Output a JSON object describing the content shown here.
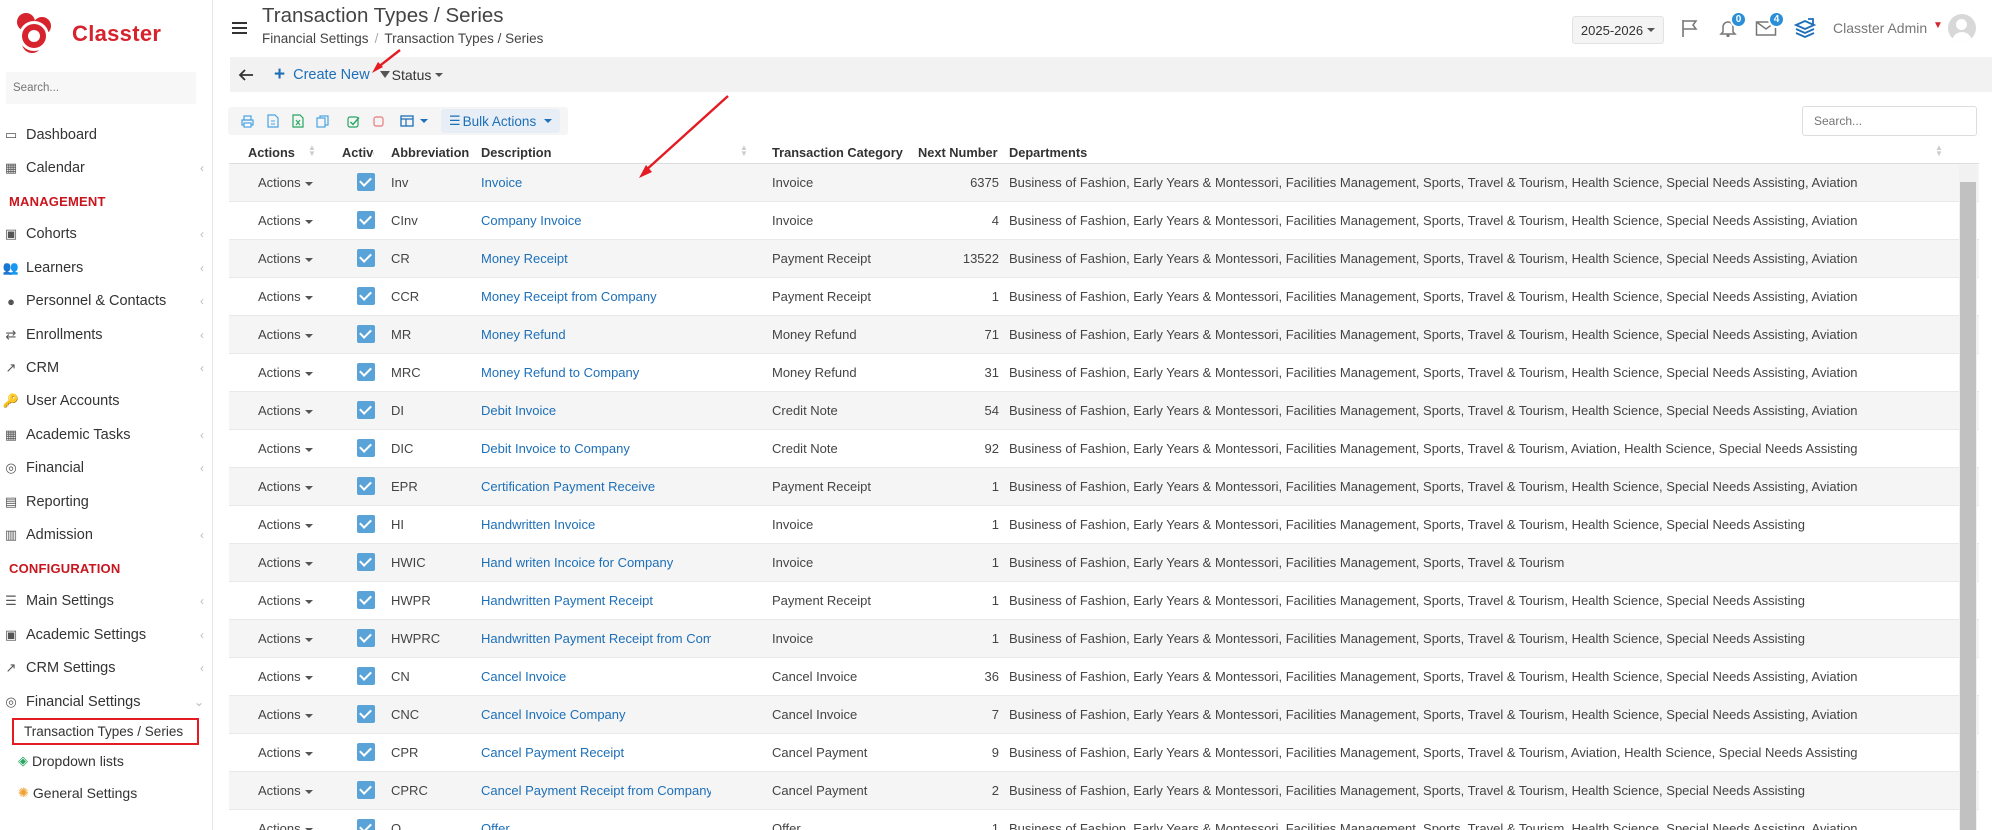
{
  "app": {
    "brand": "Classter"
  },
  "sidebar": {
    "search_placeholder": "Search...",
    "sections": [
      {
        "label": ""
      },
      {
        "label": "MANAGEMENT"
      },
      {
        "label": "CONFIGURATION"
      }
    ],
    "items": [
      {
        "label": "Dashboard",
        "icon": "laptop-icon",
        "chevron": false
      },
      {
        "label": "Calendar",
        "icon": "calendar-icon",
        "chevron": true
      },
      {
        "label": "Cohorts",
        "icon": "cohorts-icon",
        "chevron": true
      },
      {
        "label": "Learners",
        "icon": "learners-icon",
        "chevron": true
      },
      {
        "label": "Personnel & Contacts",
        "icon": "person-icon",
        "chevron": true
      },
      {
        "label": "Enrollments",
        "icon": "swap-icon",
        "chevron": true
      },
      {
        "label": "CRM",
        "icon": "trend-icon",
        "chevron": true
      },
      {
        "label": "User Accounts",
        "icon": "key-icon",
        "chevron": false
      },
      {
        "label": "Academic Tasks",
        "icon": "grid-icon",
        "chevron": true
      },
      {
        "label": "Financial",
        "icon": "coins-icon",
        "chevron": true
      },
      {
        "label": "Reporting",
        "icon": "printer-icon",
        "chevron": false
      },
      {
        "label": "Admission",
        "icon": "bank-icon",
        "chevron": true
      },
      {
        "label": "Main Settings",
        "icon": "sliders-icon",
        "chevron": true
      },
      {
        "label": "Academic Settings",
        "icon": "group-settings-icon",
        "chevron": true
      },
      {
        "label": "CRM Settings",
        "icon": "trend-icon",
        "chevron": true
      },
      {
        "label": "Financial Settings",
        "icon": "coins-icon",
        "chevron": true
      }
    ],
    "sub_items": [
      {
        "label": "Transaction Types / Series",
        "active": true
      },
      {
        "label": "Dropdown lists",
        "icon": "layers-icon"
      },
      {
        "label": "General Settings",
        "icon": "gear-icon"
      }
    ]
  },
  "header": {
    "title": "Transaction Types / Series",
    "breadcrumb": [
      "Financial Settings",
      "Transaction Types / Series"
    ],
    "year": "2025-2026",
    "notifications_count": "0",
    "messages_count": "4",
    "user_name": "Classter Admin"
  },
  "toolbar": {
    "create_label": "Create New",
    "status_label": "Status"
  },
  "table_tools": {
    "bulk_label": "Bulk Actions",
    "search_placeholder": "Search..."
  },
  "table": {
    "columns": [
      "Actions",
      "Active",
      "Abbreviation",
      "Description",
      "Transaction Category",
      "Next Number",
      "Departments"
    ],
    "action_label": "Actions",
    "rows": [
      {
        "abbr": "Inv",
        "desc": "Invoice",
        "cat": "Invoice",
        "next": "6375",
        "dept": "Business of Fashion, Early Years & Montessori, Facilities Management, Sports, Travel & Tourism, Health Science, Special Needs Assisting, Aviation"
      },
      {
        "abbr": "CInv",
        "desc": "Company Invoice",
        "cat": "Invoice",
        "next": "4",
        "dept": "Business of Fashion, Early Years & Montessori, Facilities Management, Sports, Travel & Tourism, Health Science, Special Needs Assisting, Aviation"
      },
      {
        "abbr": "CR",
        "desc": "Money Receipt",
        "cat": "Payment Receipt",
        "next": "13522",
        "dept": "Business of Fashion, Early Years & Montessori, Facilities Management, Sports, Travel & Tourism, Health Science, Special Needs Assisting, Aviation"
      },
      {
        "abbr": "CCR",
        "desc": "Money Receipt from Company",
        "cat": "Payment Receipt",
        "next": "1",
        "dept": "Business of Fashion, Early Years & Montessori, Facilities Management, Sports, Travel & Tourism, Health Science, Special Needs Assisting, Aviation"
      },
      {
        "abbr": "MR",
        "desc": "Money Refund",
        "cat": "Money Refund",
        "next": "71",
        "dept": "Business of Fashion, Early Years & Montessori, Facilities Management, Sports, Travel & Tourism, Health Science, Special Needs Assisting, Aviation"
      },
      {
        "abbr": "MRC",
        "desc": "Money Refund to Company",
        "cat": "Money Refund",
        "next": "31",
        "dept": "Business of Fashion, Early Years & Montessori, Facilities Management, Sports, Travel & Tourism, Health Science, Special Needs Assisting, Aviation"
      },
      {
        "abbr": "DI",
        "desc": "Debit Invoice",
        "cat": "Credit Note",
        "next": "54",
        "dept": "Business of Fashion, Early Years & Montessori, Facilities Management, Sports, Travel & Tourism, Health Science, Special Needs Assisting, Aviation"
      },
      {
        "abbr": "DIC",
        "desc": "Debit Invoice to Company",
        "cat": "Credit Note",
        "next": "92",
        "dept": "Business of Fashion, Early Years & Montessori, Facilities Management, Sports, Travel & Tourism, Aviation, Health Science, Special Needs Assisting"
      },
      {
        "abbr": "EPR",
        "desc": "Certification Payment Receive",
        "cat": "Payment Receipt",
        "next": "1",
        "dept": "Business of Fashion, Early Years & Montessori, Facilities Management, Sports, Travel & Tourism, Health Science, Special Needs Assisting, Aviation"
      },
      {
        "abbr": "HI",
        "desc": "Handwritten Invoice",
        "cat": "Invoice",
        "next": "1",
        "dept": "Business of Fashion, Early Years & Montessori, Facilities Management, Sports, Travel & Tourism, Health Science, Special Needs Assisting"
      },
      {
        "abbr": "HWIC",
        "desc": "Hand writen Incoice for Company",
        "cat": "Invoice",
        "next": "1",
        "dept": "Business of Fashion, Early Years & Montessori, Facilities Management, Sports, Travel & Tourism"
      },
      {
        "abbr": "HWPR",
        "desc": "Handwritten Payment Receipt",
        "cat": "Payment Receipt",
        "next": "1",
        "dept": "Business of Fashion, Early Years & Montessori, Facilities Management, Sports, Travel & Tourism, Health Science, Special Needs Assisting"
      },
      {
        "abbr": "HWPRC",
        "desc": "Handwritten Payment Receipt from Company",
        "cat": "Invoice",
        "next": "1",
        "dept": "Business of Fashion, Early Years & Montessori, Facilities Management, Sports, Travel & Tourism, Health Science, Special Needs Assisting"
      },
      {
        "abbr": "CN",
        "desc": "Cancel Invoice",
        "cat": "Cancel Invoice",
        "next": "36",
        "dept": "Business of Fashion, Early Years & Montessori, Facilities Management, Sports, Travel & Tourism, Health Science, Special Needs Assisting, Aviation"
      },
      {
        "abbr": "CNC",
        "desc": "Cancel Invoice Company",
        "cat": "Cancel Invoice",
        "next": "7",
        "dept": "Business of Fashion, Early Years & Montessori, Facilities Management, Sports, Travel & Tourism, Health Science, Special Needs Assisting, Aviation"
      },
      {
        "abbr": "CPR",
        "desc": "Cancel Payment Receipt",
        "cat": "Cancel Payment",
        "next": "9",
        "dept": "Business of Fashion, Early Years & Montessori, Facilities Management, Sports, Travel & Tourism, Aviation, Health Science, Special Needs Assisting"
      },
      {
        "abbr": "CPRC",
        "desc": "Cancel Payment Receipt from Company",
        "cat": "Cancel Payment",
        "next": "2",
        "dept": "Business of Fashion, Early Years & Montessori, Facilities Management, Sports, Travel & Tourism, Health Science, Special Needs Assisting"
      },
      {
        "abbr": "O",
        "desc": "Offer",
        "cat": "Offer",
        "next": "1",
        "dept": "Business of Fashion, Early Years & Montessori, Facilities Management, Sports, Travel & Tourism, Health Science, Special Needs Assisting, Aviation"
      }
    ]
  },
  "colors": {
    "brand": "#d6232d",
    "link": "#1d6fb8",
    "badge": "#2a8fd8",
    "checkbox": "#5aa3d8",
    "annotation": "#e41b23"
  }
}
